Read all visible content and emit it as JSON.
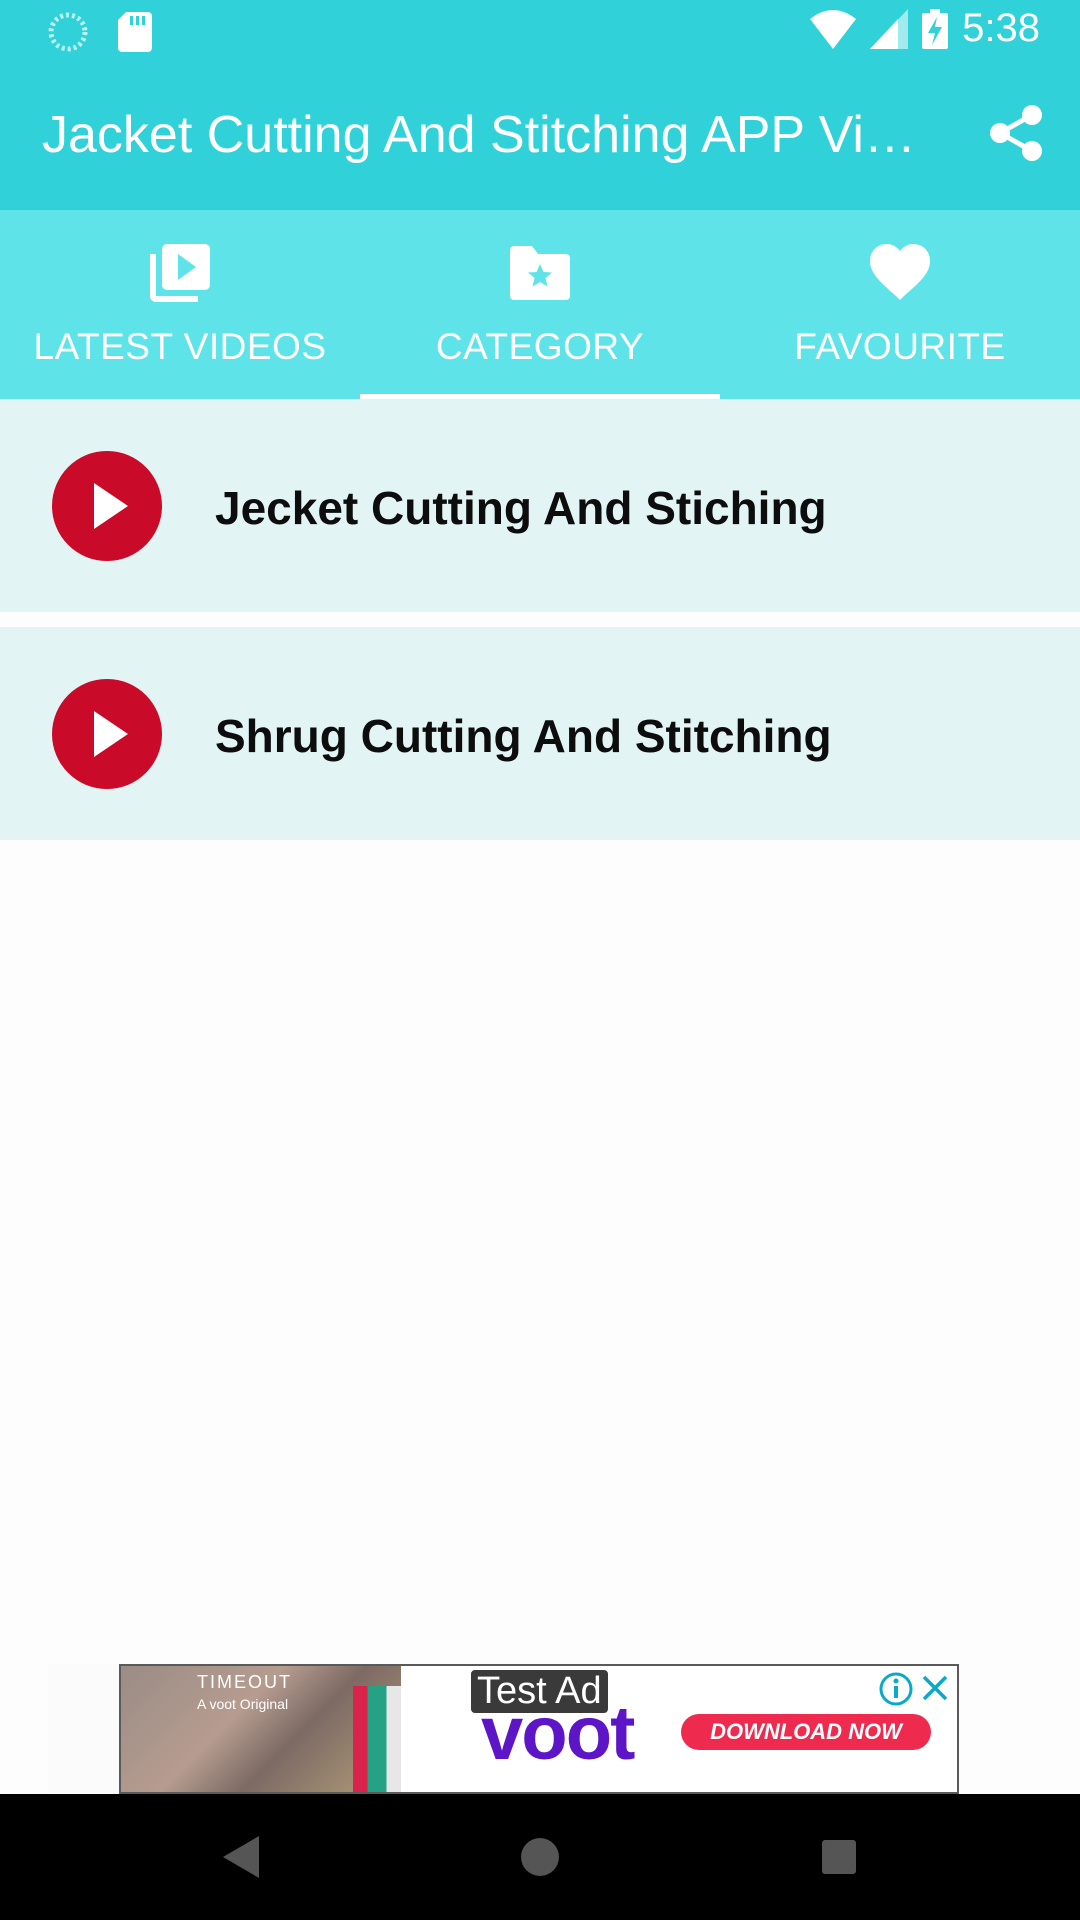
{
  "status_bar": {
    "time": "5:38"
  },
  "toolbar": {
    "title": "Jacket Cutting And Stitching APP Vi…"
  },
  "tabs": [
    {
      "label": "LATEST VIDEOS",
      "icon": "video-library-icon"
    },
    {
      "label": "CATEGORY",
      "icon": "folder-star-icon",
      "selected": true
    },
    {
      "label": "FAVOURITE",
      "icon": "heart-icon"
    }
  ],
  "list": {
    "items": [
      {
        "label": "Jecket Cutting And Stiching"
      },
      {
        "label": "Shrug Cutting And Stitching"
      }
    ]
  },
  "ad": {
    "test_label": "Test Ad",
    "brand": "voot",
    "cta": "DOWNLOAD NOW",
    "headline": "TIMEOUT",
    "subline": "A voot Original"
  },
  "colors": {
    "primary": "#30d1d8",
    "tab_bar": "#5ee4e8",
    "list_bg": "#e2f4f3",
    "play_red": "#c90a29"
  }
}
